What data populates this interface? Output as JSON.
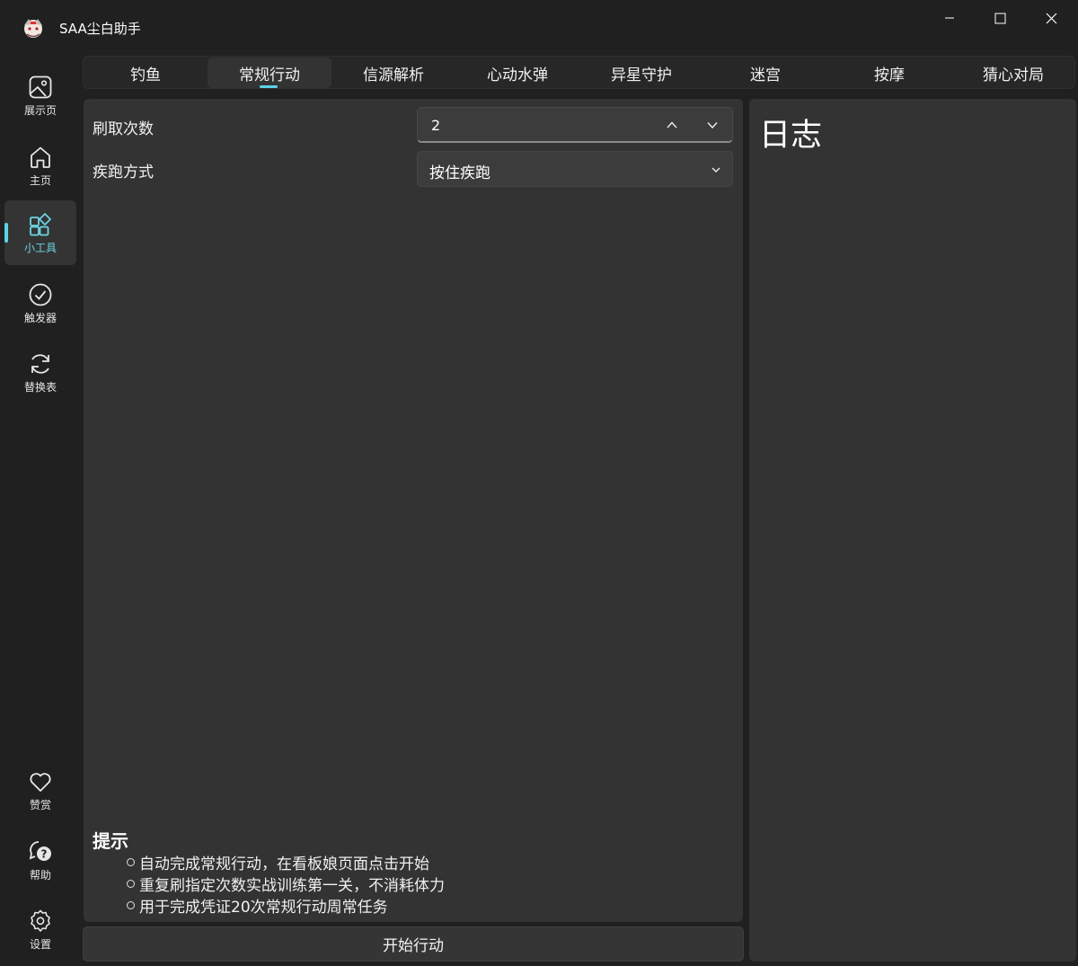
{
  "window": {
    "title": "SAA尘白助手",
    "controls": [
      "minimize-icon",
      "maximize-icon",
      "close-icon"
    ]
  },
  "sidebar": {
    "items": [
      {
        "label": "展示页",
        "icon": "image-icon"
      },
      {
        "label": "主页",
        "icon": "home-icon"
      },
      {
        "label": "小工具",
        "icon": "apps-icon",
        "active": true
      },
      {
        "label": "触发器",
        "icon": "checkmark-circle-icon"
      },
      {
        "label": "替换表",
        "icon": "sync-icon"
      }
    ],
    "bottom_items": [
      {
        "label": "赞赏",
        "icon": "heart-icon"
      },
      {
        "label": "帮助",
        "icon": "help-chat-icon"
      },
      {
        "label": "设置",
        "icon": "settings-icon"
      }
    ]
  },
  "tabs": [
    {
      "label": "钓鱼"
    },
    {
      "label": "常规行动",
      "active": true
    },
    {
      "label": "信源解析"
    },
    {
      "label": "心动水弹"
    },
    {
      "label": "异星守护"
    },
    {
      "label": "迷宫"
    },
    {
      "label": "按摩"
    },
    {
      "label": "猜心对局"
    }
  ],
  "form": {
    "count_label": "刷取次数",
    "count_value": "2",
    "run_label": "疾跑方式",
    "run_value": "按住疾跑"
  },
  "tips": {
    "title": "提示",
    "lines": [
      "自动完成常规行动，在看板娘页面点击开始",
      "重复刷指定次数实战训练第一关，不消耗体力",
      "用于完成凭证20次常规行动周常任务"
    ]
  },
  "start_button": "开始行动",
  "log": {
    "title": "日志"
  },
  "colors": {
    "accent": "#5ad3e6",
    "background": "#202020",
    "panel": "#333333"
  }
}
